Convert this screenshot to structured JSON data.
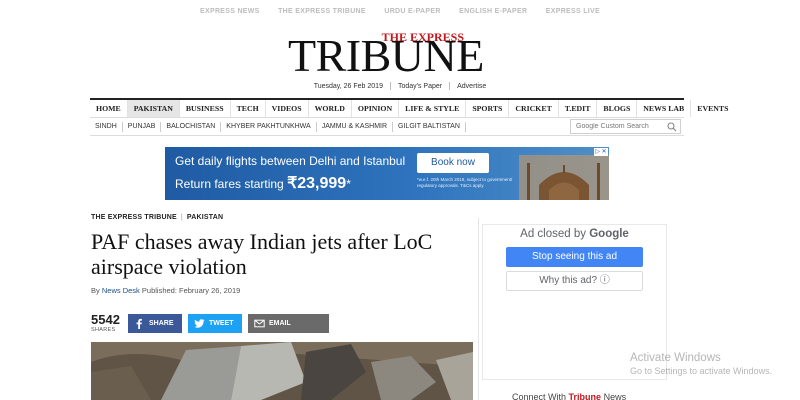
{
  "topbar": {
    "links": [
      "EXPRESS NEWS",
      "THE EXPRESS TRIBUNE",
      "URDU E-PAPER",
      "ENGLISH E-PAPER",
      "EXPRESS LIVE"
    ]
  },
  "masthead": {
    "tag": "THE EXPRESS",
    "logo": "TRIBUNE",
    "date": "Tuesday, 26 Feb 2019",
    "todays_paper": "Today's Paper",
    "advertise": "Advertise"
  },
  "main_nav": {
    "items": [
      "HOME",
      "PAKISTAN",
      "BUSINESS",
      "TECH",
      "VIDEOS",
      "WORLD",
      "OPINION",
      "LIFE & STYLE",
      "SPORTS",
      "CRICKET",
      "T.EDIT",
      "BLOGS",
      "NEWS LAB",
      "EVENTS"
    ],
    "active": "PAKISTAN"
  },
  "sub_nav": {
    "items": [
      "SINDH",
      "PUNJAB",
      "BALOCHISTAN",
      "KHYBER PAKHTUNKHWA",
      "JAMMU & KASHMIR",
      "GILGIT BALTISTAN"
    ]
  },
  "search": {
    "placeholder": "Google Custom Search",
    "icon": "magnifier-icon"
  },
  "banner_ad": {
    "line1": "Get daily flights between Delhi and Istanbul",
    "line2_prefix": "Return fares starting ",
    "price": "₹23,999",
    "price_suffix": "*",
    "button": "Book now",
    "fine_print": "*w.e.f. 20th March 2019, subject to government/ regulatory approvals. T&Cs apply.",
    "close_label": "▷ ✕",
    "colors": {
      "background": "#2e73bd",
      "button": "#ffffff"
    }
  },
  "article": {
    "breadcrumbs": [
      "THE EXPRESS TRIBUNE",
      "PAKISTAN"
    ],
    "headline": "PAF chases away Indian jets after LoC airspace violation",
    "byline_prefix": "By",
    "author": "News Desk",
    "published": "Published: February 26, 2019",
    "shares_count": "5542",
    "shares_label": "SHARES",
    "share_buttons": {
      "facebook": "SHARE",
      "twitter": "TWEET",
      "email": "EMAIL"
    }
  },
  "sidebar_ad": {
    "closed_by": "Ad closed by",
    "google": "Google",
    "stop_button": "Stop seeing this ad",
    "why_button": "Why this ad? ⓘ"
  },
  "footer": {
    "connect_prefix": "Connect With",
    "connect_brand": "Tribune",
    "connect_suffix": "News"
  },
  "watermark": {
    "title": "Activate Windows",
    "subtitle": "Go to Settings to activate Windows."
  },
  "colors": {
    "brand_red": "#c4161c",
    "facebook": "#3b5998",
    "twitter": "#1da1f2",
    "email": "#6a6a6a",
    "google_blue": "#4285f4"
  }
}
